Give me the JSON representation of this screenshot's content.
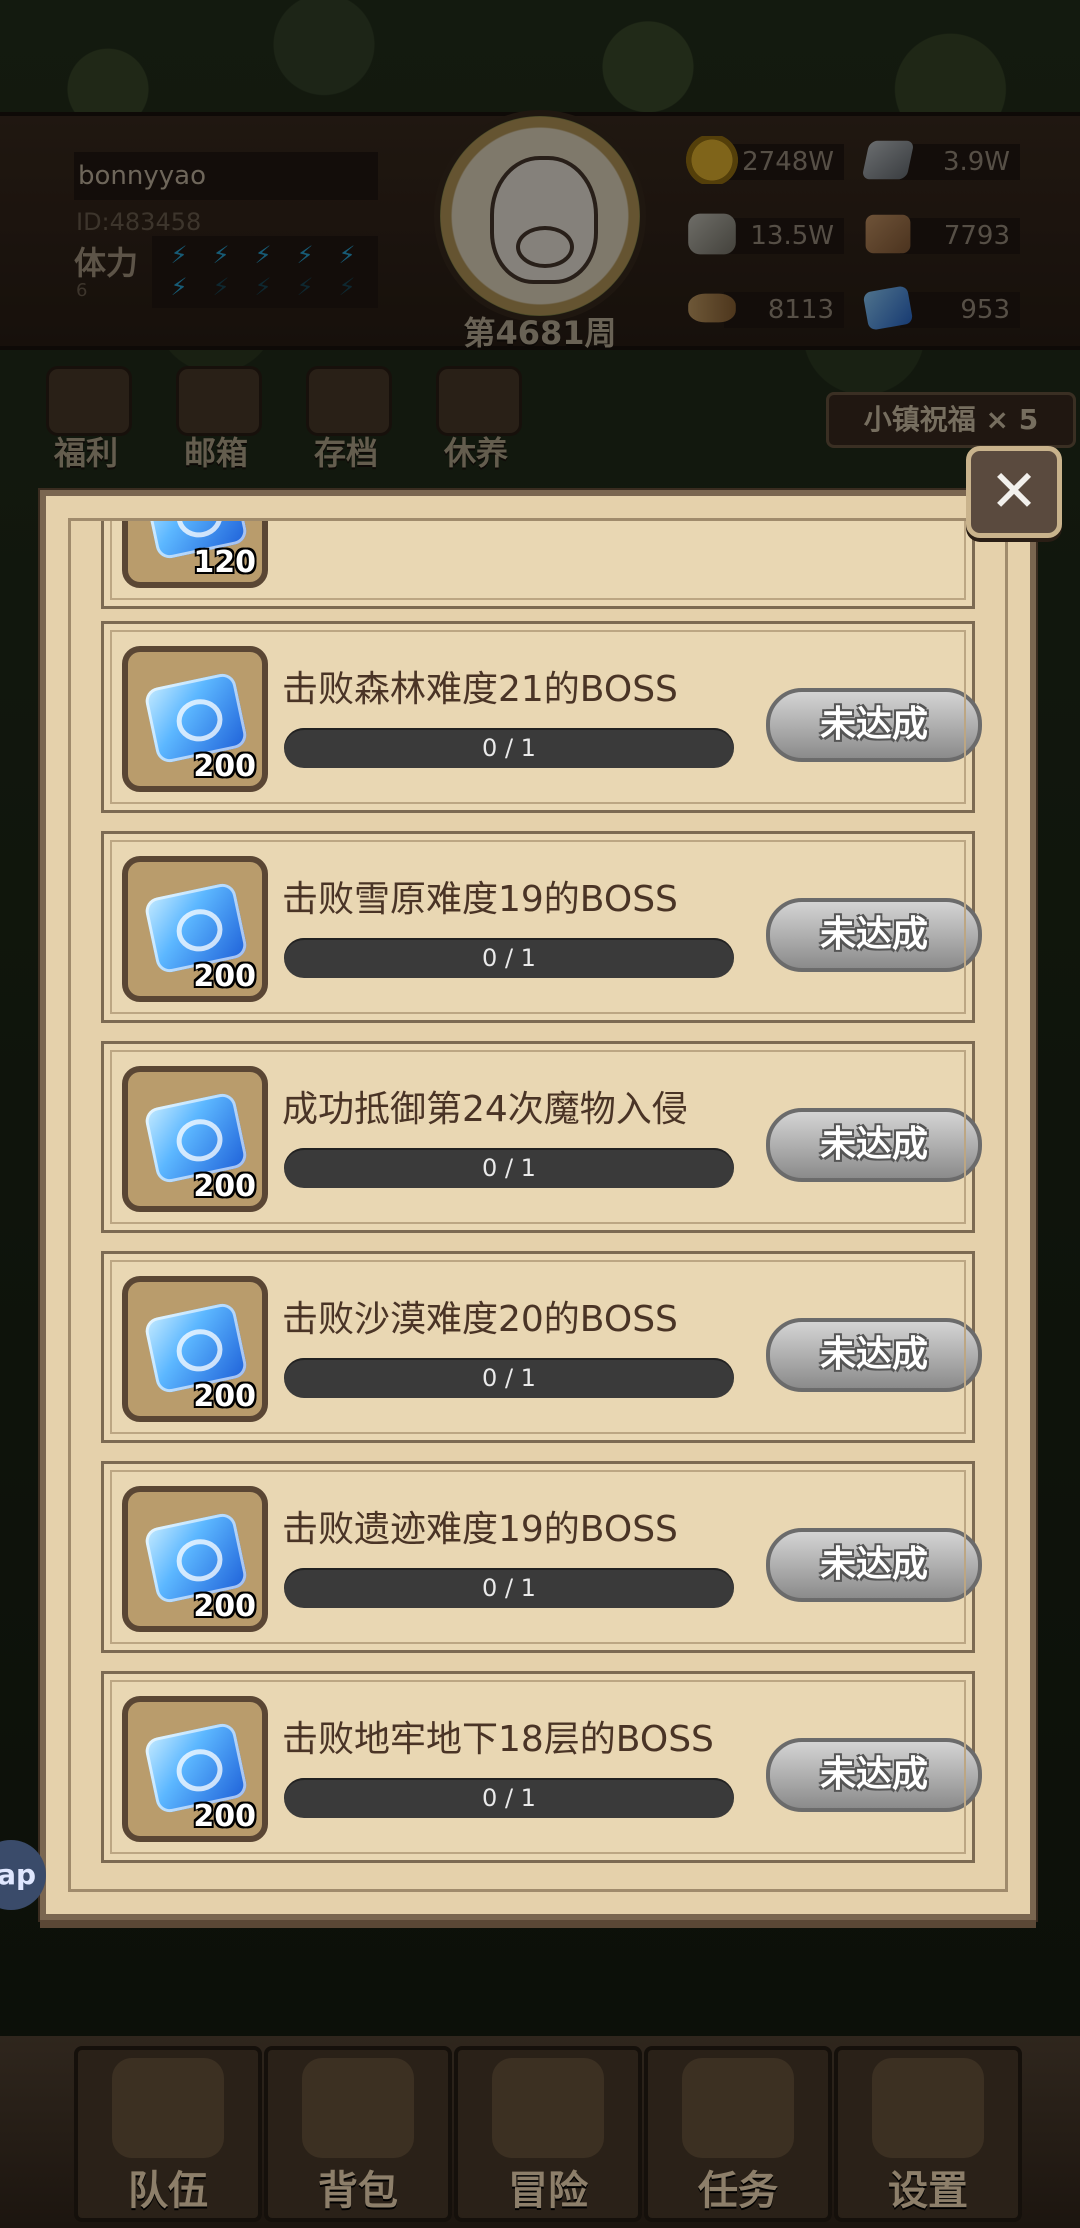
{
  "header": {
    "username": "bonnyyao",
    "user_id": "ID:483458",
    "stamina_label": "体力",
    "stamina_value": "6",
    "stamina_bolts_filled": 6,
    "stamina_bolts_total": 10,
    "week_label": "第4681周",
    "resources": [
      {
        "icon": "gold-coin-icon",
        "value": "2748W"
      },
      {
        "icon": "iron-ingot-icon",
        "value": "3.9W"
      },
      {
        "icon": "stone-icon",
        "value": "13.5W"
      },
      {
        "icon": "leather-icon",
        "value": "7793"
      },
      {
        "icon": "wood-log-icon",
        "value": "8113"
      },
      {
        "icon": "crystal-icon",
        "value": "953"
      }
    ]
  },
  "top_nav": {
    "items": [
      {
        "label": "福利",
        "icon": "shield-icon"
      },
      {
        "label": "邮箱",
        "icon": "mail-icon"
      },
      {
        "label": "存档",
        "icon": "scroll-icon"
      },
      {
        "label": "休养",
        "icon": "chest-icon"
      }
    ],
    "blessing": "小镇祝福 × 5"
  },
  "popup": {
    "partial_task": {
      "reward_count": "120"
    },
    "tasks": [
      {
        "title": "击败森林难度21的BOSS",
        "reward_count": "200",
        "progress_text": "0 / 1",
        "progress": 0,
        "status": "未达成"
      },
      {
        "title": "击败雪原难度19的BOSS",
        "reward_count": "200",
        "progress_text": "0 / 1",
        "progress": 0,
        "status": "未达成"
      },
      {
        "title": "成功抵御第24次魔物入侵",
        "reward_count": "200",
        "progress_text": "0 / 1",
        "progress": 0,
        "status": "未达成"
      },
      {
        "title": "击败沙漠难度20的BOSS",
        "reward_count": "200",
        "progress_text": "0 / 1",
        "progress": 0,
        "status": "未达成"
      },
      {
        "title": "击败遗迹难度19的BOSS",
        "reward_count": "200",
        "progress_text": "0 / 1",
        "progress": 0,
        "status": "未达成"
      },
      {
        "title": "击败地牢地下18层的BOSS",
        "reward_count": "200",
        "progress_text": "0 / 1",
        "progress": 0,
        "status": "未达成"
      }
    ],
    "close_icon": "close-x-icon"
  },
  "side_bubble": "ap",
  "bottom_nav": {
    "items": [
      {
        "label": "队伍",
        "icon": "helmet-icon"
      },
      {
        "label": "背包",
        "icon": "backpack-icon"
      },
      {
        "label": "冒险",
        "icon": "crossed-swords-icon"
      },
      {
        "label": "任务",
        "icon": "quest-scroll-icon"
      },
      {
        "label": "设置",
        "icon": "gear-icon"
      }
    ]
  }
}
